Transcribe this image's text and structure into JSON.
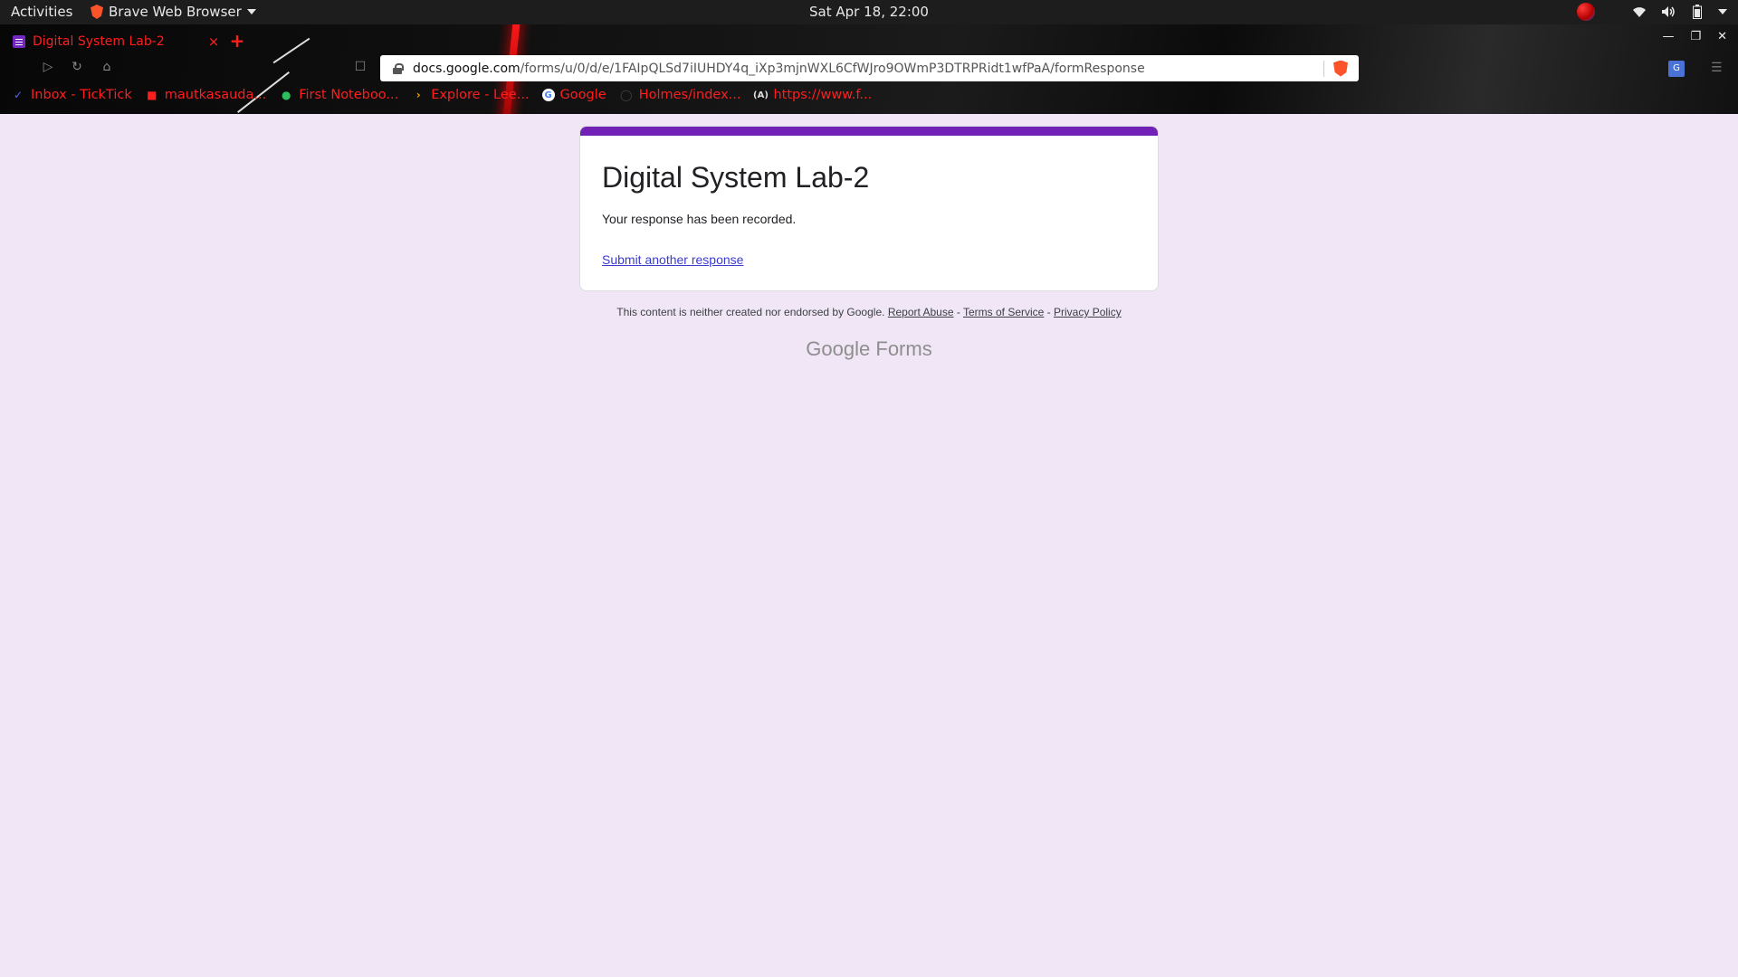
{
  "system_bar": {
    "activities": "Activities",
    "app_name": "Brave Web Browser",
    "clock": "Sat Apr 18, 22:00"
  },
  "browser": {
    "tab_title": "Digital System Lab-2",
    "tab_close": "×",
    "new_tab": "+",
    "url_domain": "docs.google.com",
    "url_path": "/forms/u/0/d/e/1FAIpQLSd7iIUHDY4q_iXp3mjnWXL6CfWJro9OWmP3DTRPRidt1wfPaA/formResponse",
    "bookmarks": [
      {
        "label": "Inbox - TickTick",
        "icon": "ticktick-icon"
      },
      {
        "label": "mautkasauda...",
        "icon": "folder-icon"
      },
      {
        "label": "First Noteboo...",
        "icon": "evernote-icon"
      },
      {
        "label": "Explore - Lee...",
        "icon": "leetcode-icon"
      },
      {
        "label": "Google",
        "icon": "google-icon"
      },
      {
        "label": "Holmes/index...",
        "icon": "github-icon"
      },
      {
        "label": "https://www.f...",
        "icon": "site-icon"
      }
    ]
  },
  "form": {
    "title": "Digital System Lab-2",
    "confirmation": "Your response has been recorded.",
    "submit_another": "Submit another response",
    "accent_color": "#7221b7"
  },
  "footer": {
    "disclaimer": "This content is neither created nor endorsed by Google.",
    "report_abuse": "Report Abuse",
    "terms": "Terms of Service",
    "privacy": "Privacy Policy",
    "separator": " - ",
    "brand_google": "Google",
    "brand_forms": "Forms"
  },
  "colors": {
    "page_bg": "#f0e6f6",
    "theme_red": "#ff1e1e"
  }
}
